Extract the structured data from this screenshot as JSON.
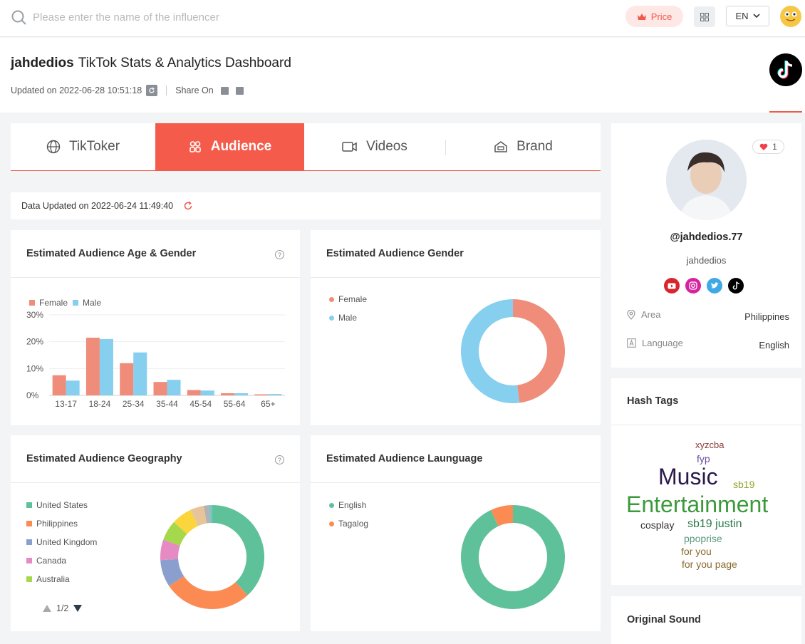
{
  "search": {
    "placeholder": "Please enter the name of the influencer"
  },
  "topbar": {
    "price_label": "Price",
    "language": "EN"
  },
  "header": {
    "username": "jahdedios",
    "subtitle": "TikTok Stats & Analytics Dashboard",
    "updated": "Updated on 2022-06-28 10:51:18",
    "share_label": "Share On"
  },
  "tabs": [
    {
      "label": "TikToker",
      "icon": "globe-icon"
    },
    {
      "label": "Audience",
      "icon": "audience-icon"
    },
    {
      "label": "Videos",
      "icon": "video-icon"
    },
    {
      "label": "Brand",
      "icon": "brand-icon"
    }
  ],
  "data_updated": "Data Updated on 2022-06-24 11:49:40",
  "cards": {
    "age_gender": "Estimated Audience Age & Gender",
    "gender": "Estimated Audience Gender",
    "geography": "Estimated Audience Geography",
    "language": "Estimated Audience Launguage"
  },
  "pager": "1/2",
  "profile": {
    "likes": "1",
    "handle": "@jahdedios.77",
    "nickname": "jahdedios",
    "area_label": "Area",
    "area_value": "Philippines",
    "language_label": "Language",
    "language_value": "English"
  },
  "hashtags_title": "Hash Tags",
  "original_sound_title": "Original Sound",
  "hashtags": [
    {
      "text": "xyzcba",
      "color": "#8b3a3a"
    },
    {
      "text": "fyp",
      "color": "#6a4fa0"
    },
    {
      "text": "Music",
      "color": "#2a1a4a"
    },
    {
      "text": "sb19",
      "color": "#8fa52a"
    },
    {
      "text": "Entertainment",
      "color": "#3a9a3a"
    },
    {
      "text": "cosplay",
      "color": "#333333"
    },
    {
      "text": "sb19 justin",
      "color": "#2a7a4a"
    },
    {
      "text": "ppoprise",
      "color": "#5a9a7a"
    },
    {
      "text": "for you",
      "color": "#8a6a2a"
    },
    {
      "text": "for you page",
      "color": "#8a6a2a"
    }
  ],
  "colors": {
    "accent": "#f45b4b",
    "female": "#ef8c7a",
    "male": "#86cfee"
  },
  "chart_data": [
    {
      "type": "bar",
      "categories": [
        "13-17",
        "18-24",
        "25-34",
        "35-44",
        "45-54",
        "55-64",
        "65+"
      ],
      "series": [
        {
          "name": "Female",
          "values": [
            7.5,
            21.5,
            12,
            5,
            2,
            0.8,
            0.4
          ],
          "color": "#ef8c7a"
        },
        {
          "name": "Male",
          "values": [
            5.5,
            21,
            16,
            5.8,
            1.8,
            0.8,
            0.5
          ],
          "color": "#86cfee"
        }
      ],
      "yticks": [
        "0%",
        "10%",
        "20%",
        "30%"
      ],
      "ylim": [
        0,
        30
      ],
      "legend": "top-left"
    },
    {
      "type": "pie",
      "donut": true,
      "labels": [
        "Female",
        "Male"
      ],
      "values": [
        48,
        52
      ],
      "colors": [
        "#ef8c7a",
        "#86cfee"
      ],
      "legend": "top-left"
    },
    {
      "type": "pie",
      "donut": true,
      "labels": [
        "United States",
        "Philippines",
        "United Kingdom",
        "Canada",
        "Australia"
      ],
      "values": [
        36,
        26,
        8,
        6,
        6,
        6,
        4,
        1.5,
        1
      ],
      "colors": [
        "#5fc19a",
        "#fb8b52",
        "#8b9fcf",
        "#e68ac3",
        "#a5d84a",
        "#fbd53c",
        "#e7c49a",
        "#b3b3b3",
        "#7fc4c4"
      ],
      "legend": "top-left"
    },
    {
      "type": "pie",
      "donut": true,
      "labels": [
        "English",
        "Tagalog"
      ],
      "values": [
        93,
        7
      ],
      "colors": [
        "#5fc19a",
        "#fb8b52"
      ],
      "legend": "top-left"
    }
  ]
}
